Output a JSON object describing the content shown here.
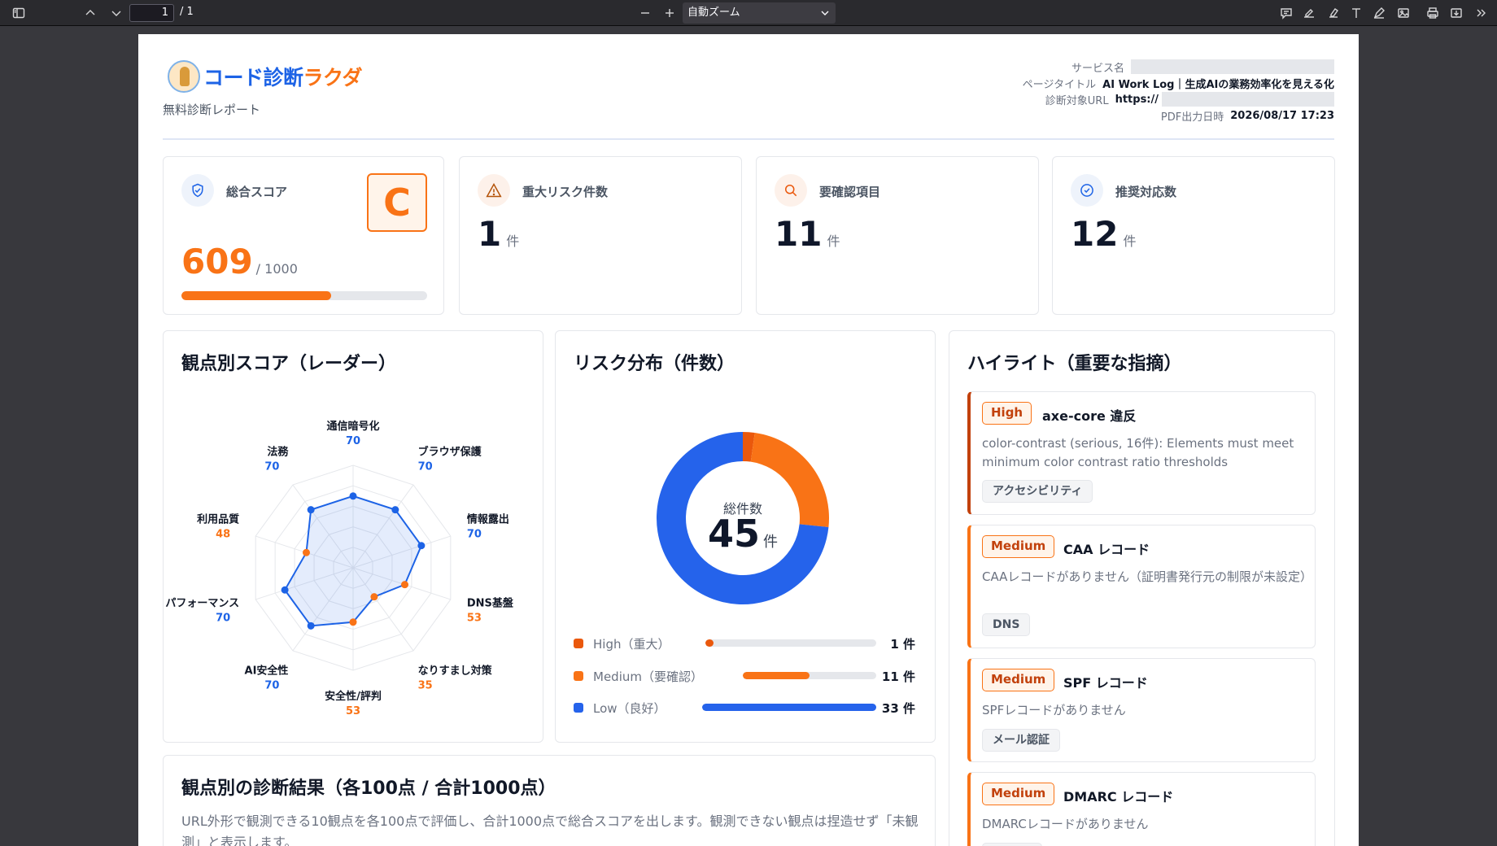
{
  "viewer": {
    "page_number": "1",
    "page_total": "/ 1",
    "zoom_label": "自動ズーム"
  },
  "header": {
    "logo_part1": "コード診断",
    "logo_part2": "ラクダ",
    "subtitle": "無料診断レポート",
    "meta": {
      "service_label": "サービス名",
      "page_title_label": "ページタイトル",
      "page_title_value": "AI Work Log｜生成AIの業務効率化を見える化",
      "url_label": "診断対象URL",
      "url_value": "https://",
      "pdf_label": "PDF出力日時",
      "pdf_value": "2026/08/17 17:23"
    }
  },
  "stats": {
    "score": {
      "label": "総合スコア",
      "value": "609",
      "max": "/ 1000",
      "grade": "C",
      "progress": 0.609
    },
    "critical": {
      "label": "重大リスク件数",
      "value": "1",
      "unit": "件"
    },
    "review": {
      "label": "要確認項目",
      "value": "11",
      "unit": "件"
    },
    "recommend": {
      "label": "推奨対応数",
      "value": "12",
      "unit": "件"
    }
  },
  "radar": {
    "title": "観点別スコア（レーダー）",
    "max": 100,
    "axes": [
      {
        "label": "通信暗号化",
        "score": 70
      },
      {
        "label": "ブラウザ保護",
        "score": 70
      },
      {
        "label": "情報露出",
        "score": 70
      },
      {
        "label": "DNS基盤",
        "score": 53
      },
      {
        "label": "なりすまし対策",
        "score": 35
      },
      {
        "label": "安全性/評判",
        "score": 53
      },
      {
        "label": "AI安全性",
        "score": 70
      },
      {
        "label": "パフォーマンス",
        "score": 70
      },
      {
        "label": "利用品質",
        "score": 48
      },
      {
        "label": "法務",
        "score": 70
      }
    ],
    "colors": {
      "good": "#1d63e6",
      "warn": "#f97316"
    }
  },
  "risk": {
    "title": "リスク分布（件数）",
    "center_label": "総件数",
    "center_value": "45",
    "center_unit": "件",
    "chart_data": {
      "type": "pie",
      "categories": [
        "High（重大）",
        "Medium（要確認）",
        "Low（良好）"
      ],
      "values": [
        1,
        11,
        33
      ],
      "colors": [
        "#ea580c",
        "#f97316",
        "#2563eb"
      ]
    },
    "legend": [
      {
        "label": "High（重大）",
        "count": "1 件",
        "value": 1,
        "color": "#ea580c"
      },
      {
        "label": "Medium（要確認）",
        "count": "11 件",
        "value": 11,
        "color": "#f97316"
      },
      {
        "label": "Low（良好）",
        "count": "33 件",
        "value": 33,
        "color": "#2563eb"
      }
    ]
  },
  "highlights": {
    "title": "ハイライト（重要な指摘）",
    "items": [
      {
        "badge": "High",
        "title": "axe-core 違反",
        "desc": "color-contrast (serious, 16件): Elements must meet minimum color contrast ratio thresholds",
        "tag": "アクセシビリティ"
      },
      {
        "badge": "Medium",
        "title": "CAA レコード",
        "desc": "CAAレコードがありません（証明書発行元の制限が未設定）",
        "tag": "DNS"
      },
      {
        "badge": "Medium",
        "title": "SPF レコード",
        "desc": "SPFレコードがありません",
        "tag": "メール認証"
      },
      {
        "badge": "Medium",
        "title": "DMARC レコード",
        "desc": "DMARCレコードがありません",
        "tag": ""
      }
    ]
  },
  "results": {
    "title": "観点別の診断結果（各100点 / 合計1000点）",
    "desc": "URL外形で観測できる10観点を各100点で評価し、合計1000点で総合スコアを出します。観測できない観点は捏造せず「未観測」と表示します。"
  }
}
